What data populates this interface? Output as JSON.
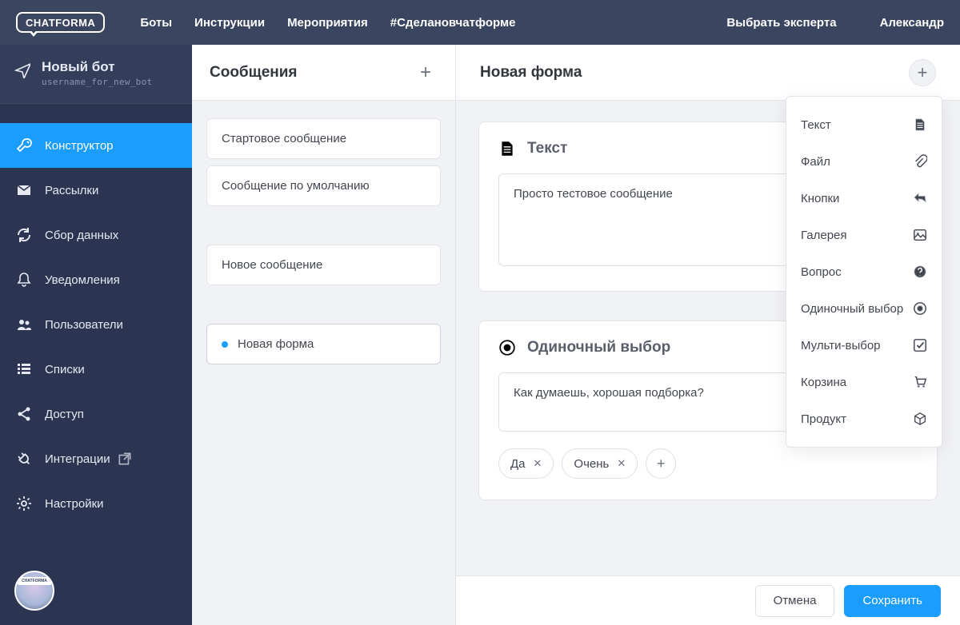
{
  "brand": "CHATFORMA",
  "topnav": {
    "links": [
      "Боты",
      "Инструкции",
      "Мероприятия",
      "#Сделановчатформе"
    ],
    "expert": "Выбрать эксперта",
    "user": "Александр"
  },
  "bot": {
    "title": "Новый бот",
    "username": "username_for_new_bot"
  },
  "sidebar": {
    "items": [
      {
        "label": "Конструктор",
        "icon": "wrench",
        "active": true
      },
      {
        "label": "Рассылки",
        "icon": "mail"
      },
      {
        "label": "Сбор данных",
        "icon": "refresh"
      },
      {
        "label": "Уведомления",
        "icon": "bell"
      },
      {
        "label": "Пользователи",
        "icon": "users"
      },
      {
        "label": "Списки",
        "icon": "list"
      },
      {
        "label": "Доступ",
        "icon": "share"
      },
      {
        "label": "Интеграции",
        "icon": "plug",
        "external": true
      },
      {
        "label": "Настройки",
        "icon": "gear"
      }
    ]
  },
  "messages": {
    "title": "Сообщения",
    "items": [
      {
        "label": "Стартовое сообщение"
      },
      {
        "label": "Сообщение по умолчанию"
      },
      {
        "label": "Новое сообщение"
      },
      {
        "label": "Новая форма",
        "selected": true
      }
    ]
  },
  "form": {
    "title": "Новая форма",
    "blocks": [
      {
        "type": "text",
        "title": "Текст",
        "value": "Просто тестовое сообщение"
      },
      {
        "type": "single",
        "title": "Одиночный выбор",
        "value": "Как думаешь, хорошая подборка?",
        "options": [
          "Да",
          "Очень"
        ]
      }
    ]
  },
  "dropdown": {
    "items": [
      {
        "label": "Текст",
        "icon": "doc"
      },
      {
        "label": "Файл",
        "icon": "clip"
      },
      {
        "label": "Кнопки",
        "icon": "reply"
      },
      {
        "label": "Галерея",
        "icon": "image"
      },
      {
        "label": "Вопрос",
        "icon": "help"
      },
      {
        "label": "Одиночный выбор",
        "icon": "radio"
      },
      {
        "label": "Мульти-выбор",
        "icon": "check"
      },
      {
        "label": "Корзина",
        "icon": "cart"
      },
      {
        "label": "Продукт",
        "icon": "box"
      }
    ]
  },
  "footer": {
    "cancel": "Отмена",
    "save": "Сохранить"
  }
}
